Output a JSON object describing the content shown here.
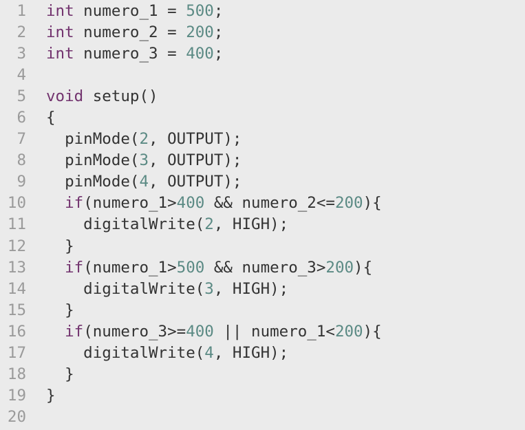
{
  "editor": {
    "colors": {
      "background": "#ebebeb",
      "line_number": "#9a9a9a",
      "keyword": "#72336e",
      "number": "#5b8a84",
      "text": "#333333"
    },
    "lines": [
      {
        "n": "1",
        "tokens": [
          {
            "t": "kw",
            "v": "int"
          },
          {
            "t": "txt",
            "v": " numero_1 = "
          },
          {
            "t": "num",
            "v": "500"
          },
          {
            "t": "txt",
            "v": ";"
          }
        ]
      },
      {
        "n": "2",
        "tokens": [
          {
            "t": "kw",
            "v": "int"
          },
          {
            "t": "txt",
            "v": " numero_2 = "
          },
          {
            "t": "num",
            "v": "200"
          },
          {
            "t": "txt",
            "v": ";"
          }
        ]
      },
      {
        "n": "3",
        "tokens": [
          {
            "t": "kw",
            "v": "int"
          },
          {
            "t": "txt",
            "v": " numero_3 = "
          },
          {
            "t": "num",
            "v": "400"
          },
          {
            "t": "txt",
            "v": ";"
          }
        ]
      },
      {
        "n": "4",
        "tokens": []
      },
      {
        "n": "5",
        "tokens": [
          {
            "t": "kw",
            "v": "void"
          },
          {
            "t": "txt",
            "v": " setup()"
          }
        ]
      },
      {
        "n": "6",
        "tokens": [
          {
            "t": "txt",
            "v": "{"
          }
        ]
      },
      {
        "n": "7",
        "tokens": [
          {
            "t": "txt",
            "v": "  pinMode("
          },
          {
            "t": "num",
            "v": "2"
          },
          {
            "t": "txt",
            "v": ", OUTPUT);"
          }
        ]
      },
      {
        "n": "8",
        "tokens": [
          {
            "t": "txt",
            "v": "  pinMode("
          },
          {
            "t": "num",
            "v": "3"
          },
          {
            "t": "txt",
            "v": ", OUTPUT);"
          }
        ]
      },
      {
        "n": "9",
        "tokens": [
          {
            "t": "txt",
            "v": "  pinMode("
          },
          {
            "t": "num",
            "v": "4"
          },
          {
            "t": "txt",
            "v": ", OUTPUT);"
          }
        ]
      },
      {
        "n": "10",
        "tokens": [
          {
            "t": "txt",
            "v": "  "
          },
          {
            "t": "kw",
            "v": "if"
          },
          {
            "t": "txt",
            "v": "(numero_1>"
          },
          {
            "t": "num",
            "v": "400"
          },
          {
            "t": "txt",
            "v": " && numero_2<="
          },
          {
            "t": "num",
            "v": "200"
          },
          {
            "t": "txt",
            "v": "){"
          }
        ]
      },
      {
        "n": "11",
        "tokens": [
          {
            "t": "txt",
            "v": "    digitalWrite("
          },
          {
            "t": "num",
            "v": "2"
          },
          {
            "t": "txt",
            "v": ", HIGH);"
          }
        ]
      },
      {
        "n": "12",
        "tokens": [
          {
            "t": "txt",
            "v": "  }"
          }
        ]
      },
      {
        "n": "13",
        "tokens": [
          {
            "t": "txt",
            "v": "  "
          },
          {
            "t": "kw",
            "v": "if"
          },
          {
            "t": "txt",
            "v": "(numero_1>"
          },
          {
            "t": "num",
            "v": "500"
          },
          {
            "t": "txt",
            "v": " && numero_3>"
          },
          {
            "t": "num",
            "v": "200"
          },
          {
            "t": "txt",
            "v": "){"
          }
        ]
      },
      {
        "n": "14",
        "tokens": [
          {
            "t": "txt",
            "v": "    digitalWrite("
          },
          {
            "t": "num",
            "v": "3"
          },
          {
            "t": "txt",
            "v": ", HIGH);"
          }
        ]
      },
      {
        "n": "15",
        "tokens": [
          {
            "t": "txt",
            "v": "  }"
          }
        ]
      },
      {
        "n": "16",
        "tokens": [
          {
            "t": "txt",
            "v": "  "
          },
          {
            "t": "kw",
            "v": "if"
          },
          {
            "t": "txt",
            "v": "(numero_3>="
          },
          {
            "t": "num",
            "v": "400"
          },
          {
            "t": "txt",
            "v": " || numero_1<"
          },
          {
            "t": "num",
            "v": "200"
          },
          {
            "t": "txt",
            "v": "){"
          }
        ]
      },
      {
        "n": "17",
        "tokens": [
          {
            "t": "txt",
            "v": "    digitalWrite("
          },
          {
            "t": "num",
            "v": "4"
          },
          {
            "t": "txt",
            "v": ", HIGH);"
          }
        ]
      },
      {
        "n": "18",
        "tokens": [
          {
            "t": "txt",
            "v": "  }"
          }
        ]
      },
      {
        "n": "19",
        "tokens": [
          {
            "t": "txt",
            "v": "}"
          }
        ]
      },
      {
        "n": "20",
        "tokens": []
      }
    ]
  }
}
